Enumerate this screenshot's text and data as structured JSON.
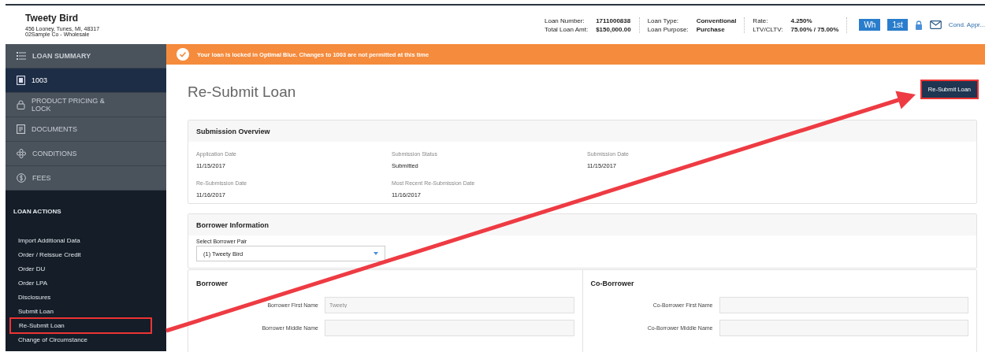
{
  "borrower_header": {
    "name": "Tweety Bird",
    "address": "456 Looney, Tunes, MI, 48317",
    "company": "02Sample Co - Wholesale"
  },
  "loan_info": [
    {
      "label": "Loan Number:",
      "value": "1711000838"
    },
    {
      "label": "Total Loan Amt:",
      "value": "$150,000.00"
    },
    {
      "label": "Loan Type:",
      "value": "Conventional"
    },
    {
      "label": "Loan Purpose:",
      "value": "Purchase"
    },
    {
      "label": "Rate:",
      "value": "4.250%"
    },
    {
      "label": "LTV/CLTV:",
      "value": "75.00% / 75.00%"
    }
  ],
  "header_badges": [
    "Wh",
    "1st"
  ],
  "header_link": "Cond. Appr...",
  "sidebar": {
    "items": [
      {
        "label": "LOAN SUMMARY",
        "kind": "list",
        "selected": false
      },
      {
        "label": "1003",
        "kind": "form",
        "selected": true
      },
      {
        "label": "PRODUCT PRICING & LOCK",
        "kind": "lock",
        "selected": false
      },
      {
        "label": "DOCUMENTS",
        "kind": "document",
        "selected": false
      },
      {
        "label": "CONDITIONS",
        "kind": "conditions",
        "selected": false
      },
      {
        "label": "FEES",
        "kind": "fees",
        "selected": false
      }
    ],
    "actions_title": "LOAN ACTIONS",
    "actions": [
      {
        "label": "Import Additional Data",
        "highlighted": false
      },
      {
        "label": "Order / Reissue Credit",
        "highlighted": false
      },
      {
        "label": "Order DU",
        "highlighted": false
      },
      {
        "label": "Order LPA",
        "highlighted": false
      },
      {
        "label": "Disclosures",
        "highlighted": false
      },
      {
        "label": "Submit Loan",
        "highlighted": false
      },
      {
        "label": "Re-Submit Loan",
        "highlighted": true
      },
      {
        "label": "Change of Circumstance",
        "highlighted": false
      }
    ]
  },
  "alert": "Your loan is locked in Optimal Blue. Changes to 1003 are not permitted at this time",
  "page": {
    "title": "Re-Submit Loan",
    "button": {
      "label": "Re-Submit Loan",
      "highlighted": true
    }
  },
  "submission_overview": {
    "title": "Submission Overview",
    "fields": [
      {
        "label": "Application Date",
        "value": "11/15/2017"
      },
      {
        "label": "Submission Status",
        "value": "Submitted"
      },
      {
        "label": "Submission Date",
        "value": "11/15/2017"
      },
      {
        "label": "Re-Submission Date",
        "value": "11/16/2017"
      },
      {
        "label": "Most Recent Re-Submission Date",
        "value": "11/16/2017"
      }
    ]
  },
  "borrower_information": {
    "title": "Borrower Information",
    "select_label": "Select Borrower Pair",
    "select_value": "(1) Tweety Bird"
  },
  "borrower": {
    "title": "Borrower",
    "fields": [
      {
        "label": "Borrower First Name",
        "placeholder": "Tweety"
      },
      {
        "label": "Borrower Middle Name"
      }
    ]
  },
  "co_borrower": {
    "title": "Co-Borrower",
    "fields": [
      {
        "label": "Co-Borrower First Name"
      },
      {
        "label": "Co-Borrower Middle Name"
      }
    ]
  }
}
